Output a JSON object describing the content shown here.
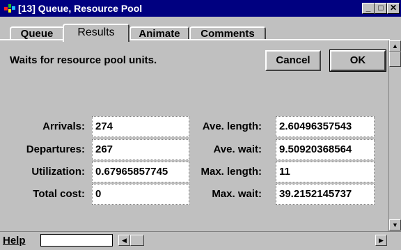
{
  "window": {
    "title": "[13]   Queue, Resource Pool",
    "minimize_glyph": "_",
    "maximize_glyph": "□",
    "close_glyph": "✕"
  },
  "tabs": [
    {
      "label": "Queue",
      "active": false
    },
    {
      "label": "Results",
      "active": true
    },
    {
      "label": "Animate",
      "active": false
    },
    {
      "label": "Comments",
      "active": false
    }
  ],
  "description": "Waits for resource pool units.",
  "buttons": {
    "cancel": "Cancel",
    "ok": "OK"
  },
  "stats_left": [
    {
      "label": "Arrivals:",
      "value": "274"
    },
    {
      "label": "Departures:",
      "value": "267"
    },
    {
      "label": "Utilization:",
      "value": "0.67965857745"
    },
    {
      "label": "Total cost:",
      "value": "0"
    }
  ],
  "stats_right": [
    {
      "label": "Ave. length:",
      "value": "2.60496357543"
    },
    {
      "label": "Ave. wait:",
      "value": "9.50920368564"
    },
    {
      "label": "Max. length:",
      "value": "11"
    },
    {
      "label": "Max. wait:",
      "value": "39.2152145737"
    }
  ],
  "footer": {
    "help_label": "Help",
    "help_value": ""
  },
  "scroll_glyphs": {
    "up": "▲",
    "down": "▼",
    "left": "◀",
    "right": "▶"
  }
}
